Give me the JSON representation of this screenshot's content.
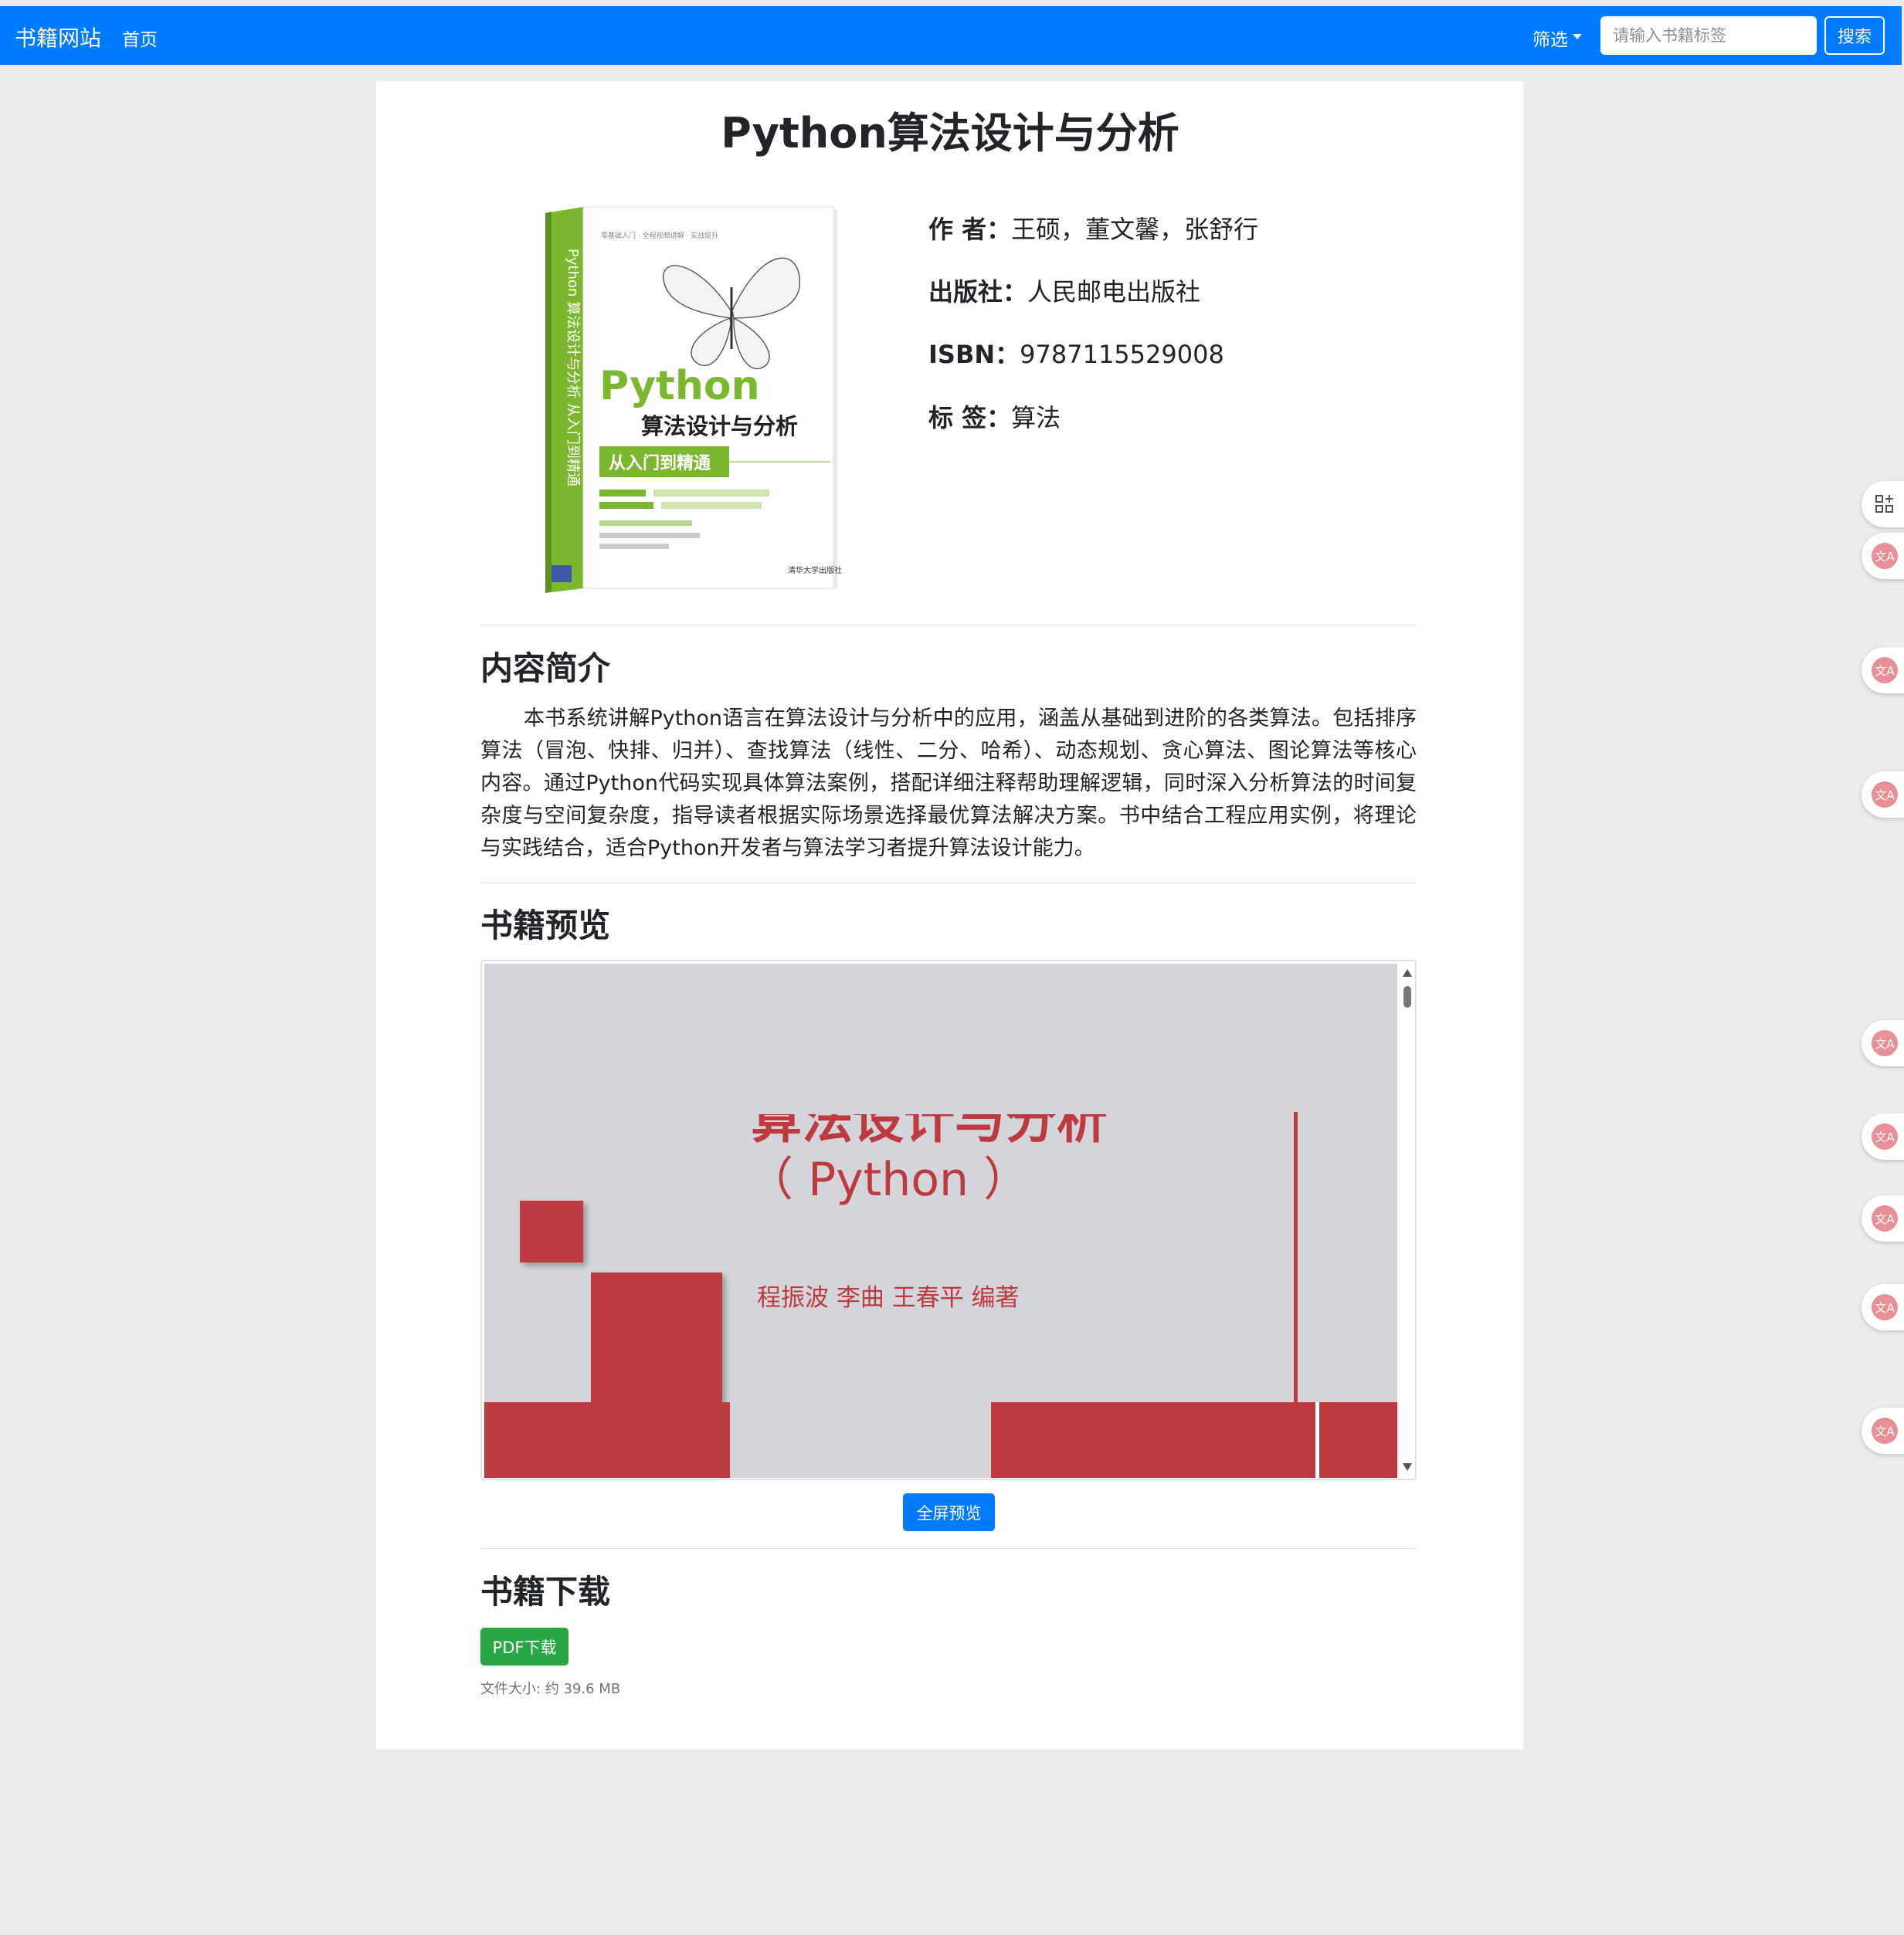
{
  "navbar": {
    "brand": "书籍网站",
    "home_link": "首页",
    "filter_label": "筛选",
    "search_placeholder": "请输入书籍标签",
    "search_button": "搜索"
  },
  "book": {
    "title": "Python算法设计与分析",
    "author_label": "作 者：",
    "author": "王硕，董文馨，张舒行",
    "publisher_label": "出版社：",
    "publisher": "人民邮电出版社",
    "isbn_label": "ISBN：",
    "isbn": "9787115529008",
    "tags_label": "标 签：",
    "tags": "算法",
    "cover": {
      "title_en": "Python",
      "title_cn": "算法设计与分析",
      "subtitle": "从入门到精通",
      "spine_text": "Python 算法设计与分析 从入门到精通",
      "tagline": "零基础入门 · 全程视频讲解 · 实战提升",
      "publisher_mark": "清华大学出版社"
    }
  },
  "summary": {
    "heading": "内容简介",
    "text": "本书系统讲解Python语言在算法设计与分析中的应用，涵盖从基础到进阶的各类算法。包括排序算法（冒泡、快排、归并）、查找算法（线性、二分、哈希）、动态规划、贪心算法、图论算法等核心内容。通过Python代码实现具体算法案例，搭配详细注释帮助理解逻辑，同时深入分析算法的时间复杂度与空间复杂度，指导读者根据实际场景选择最优算法解决方案。书中结合工程应用实例，将理论与实践结合，适合Python开发者与算法学习者提升算法设计能力。"
  },
  "preview": {
    "heading": "书籍预览",
    "page_title_cut": "算法设计与分析",
    "page_title_python": "（ Python ）",
    "page_authors": "程振波   李曲   王春平   编著",
    "fullscreen_button": "全屏预览"
  },
  "download": {
    "heading": "书籍下载",
    "pdf_button": "PDF下载",
    "file_size": "文件大小: 约 39.6 MB"
  },
  "colors": {
    "navbar": "#007bff",
    "page_background": "#ececec",
    "download_button": "#28a745",
    "preview_red": "#bd3a41",
    "cover_green": "#7cb82f"
  },
  "sidebar_icons": [
    "apps-add-icon",
    "translate-icon",
    "translate-icon",
    "translate-icon",
    "translate-icon",
    "translate-icon",
    "translate-icon",
    "translate-icon",
    "translate-icon"
  ]
}
